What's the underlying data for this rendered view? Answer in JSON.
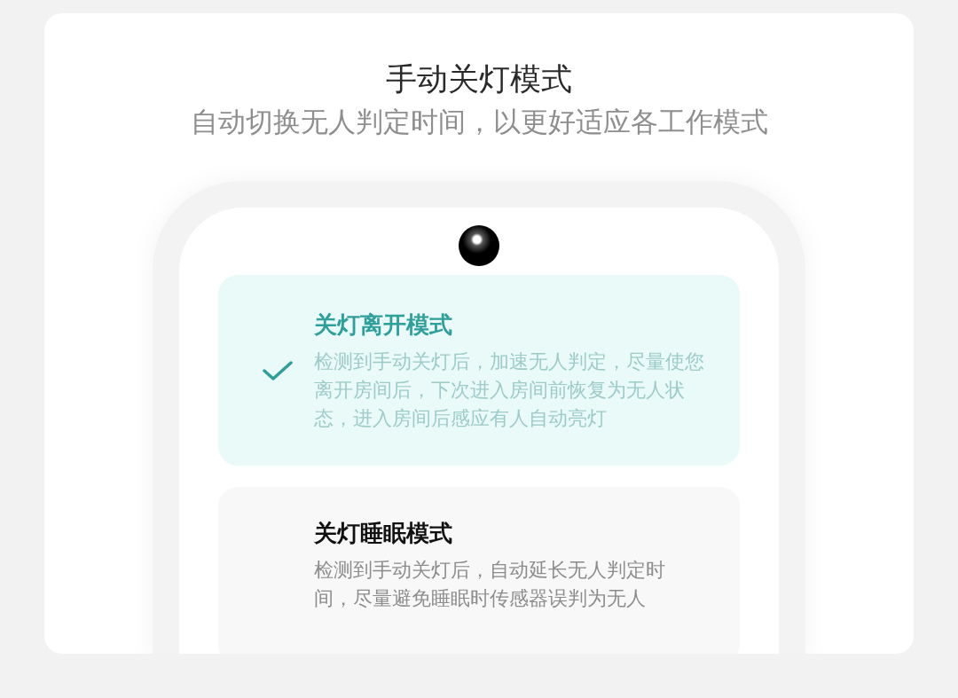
{
  "header": {
    "title": "手动关灯模式",
    "subtitle": "自动切换无人判定时间，以更好适应各工作模式"
  },
  "options": [
    {
      "title": "关灯离开模式",
      "description_lines": [
        "检测到手动关灯后，加速无人判定，尽量使您",
        "离开房间后，下次进入房间前恢复为无人状",
        "态，进入房间后感应有人自动亮灯"
      ],
      "selected": true
    },
    {
      "title": "关灯睡眠模式",
      "description_lines": [
        "检测到手动关灯后，自动延长无人判定时",
        "间，尽量避免睡眠时传感器误判为无人"
      ],
      "selected": false
    }
  ]
}
